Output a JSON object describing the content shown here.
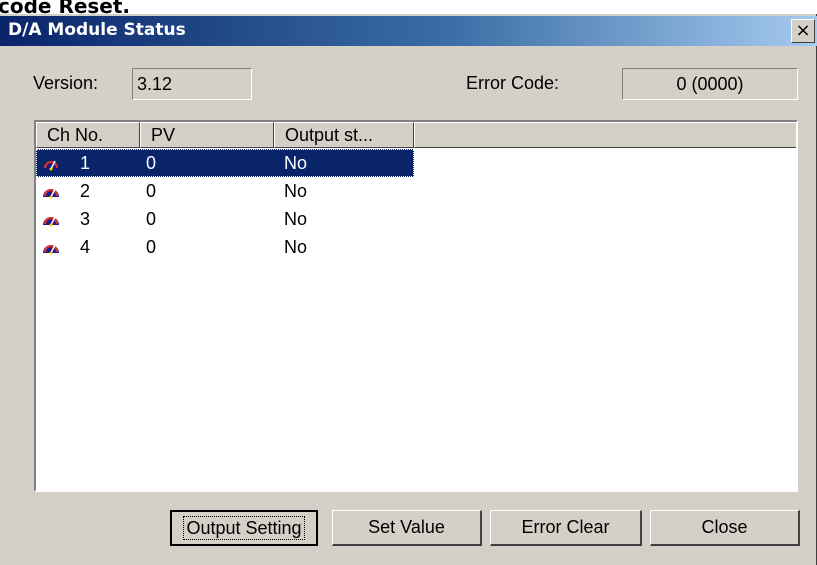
{
  "background_text": "code Reset.",
  "window": {
    "title": "D/A Module Status",
    "close_glyph": "×"
  },
  "version": {
    "label": "Version:",
    "value": "3.12"
  },
  "error_code": {
    "label": "Error Code:",
    "value": "0 (0000)"
  },
  "list": {
    "columns": [
      "Ch No.",
      "PV",
      "Output st..."
    ],
    "rows": [
      {
        "ch": "1",
        "pv": "0",
        "output": "No",
        "selected": true
      },
      {
        "ch": "2",
        "pv": "0",
        "output": "No",
        "selected": false
      },
      {
        "ch": "3",
        "pv": "0",
        "output": "No",
        "selected": false
      },
      {
        "ch": "4",
        "pv": "0",
        "output": "No",
        "selected": false
      }
    ],
    "row_icon": "gauge-icon"
  },
  "buttons": {
    "output_setting": "Output Setting",
    "set_value": "Set Value",
    "error_clear": "Error Clear",
    "close": "Close"
  },
  "colors": {
    "titlebar_start": "#0a246a",
    "titlebar_end": "#a6caf0",
    "dialog_face": "#d4d0c8",
    "selection": "#0a246a"
  }
}
